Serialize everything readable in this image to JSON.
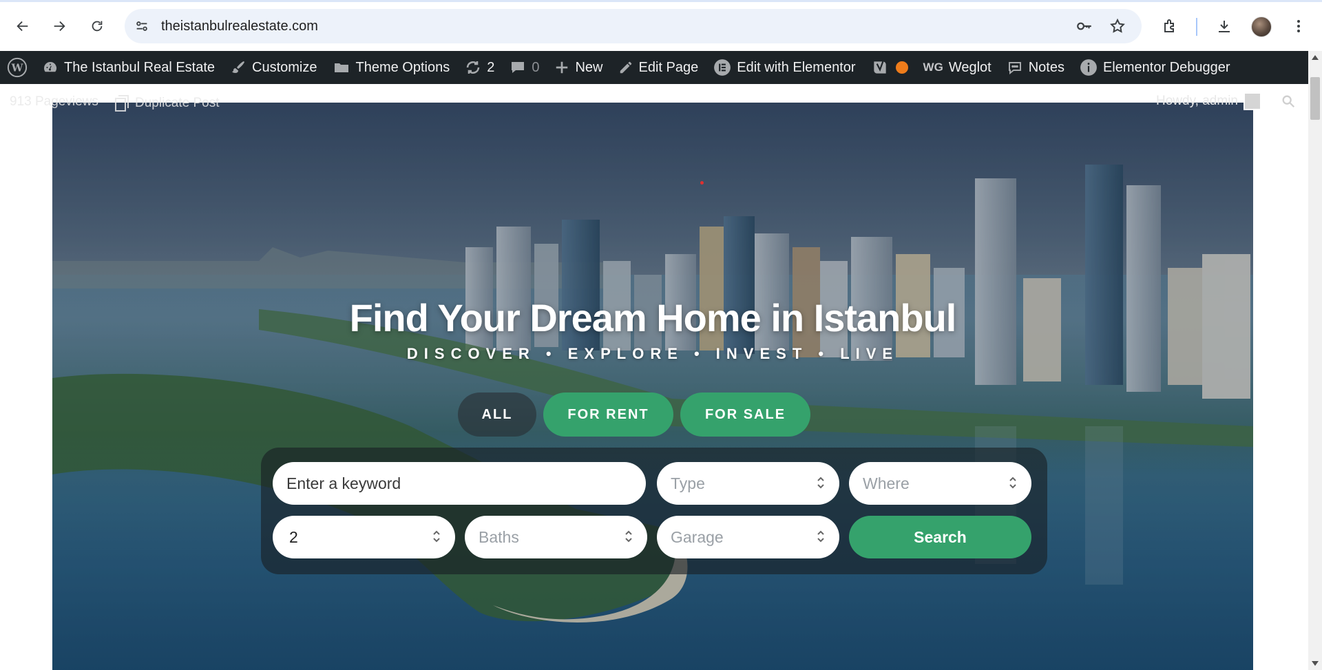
{
  "browser": {
    "url": "theistanbulrealestate.com",
    "icons": [
      "back-icon",
      "forward-icon",
      "reload-icon",
      "site-info-icon",
      "password-key-icon",
      "bookmark-star-icon",
      "extensions-icon",
      "downloads-icon",
      "profile-avatar",
      "menu-icon"
    ]
  },
  "admin_bar": {
    "site_name": "The Istanbul Real Estate",
    "customize": "Customize",
    "theme_options": "Theme Options",
    "updates_count": "2",
    "comments_count": "0",
    "new": "New",
    "edit_page": "Edit Page",
    "edit_elementor": "Edit with Elementor",
    "weglot": "Weglot",
    "weglot_badge": "WG",
    "notes": "Notes",
    "debugger": "Elementor Debugger"
  },
  "second_bar": {
    "pageviews": "913 Pageviews",
    "duplicate": "Duplicate Post",
    "howdy": "Howdy, admin"
  },
  "hero": {
    "title": "Find Your Dream Home in Istanbul",
    "subtitle": "DISCOVER • EXPLORE • INVEST • LIVE",
    "tabs": {
      "all": "ALL",
      "rent": "FOR RENT",
      "sale": "FOR SALE"
    }
  },
  "search": {
    "keyword_placeholder": "Enter a keyword",
    "type": "Type",
    "where": "Where",
    "beds": "2",
    "baths": "Baths",
    "garage": "Garage",
    "button": "Search"
  },
  "colors": {
    "accent": "#35a26c",
    "admin_bar": "#1d2327"
  }
}
